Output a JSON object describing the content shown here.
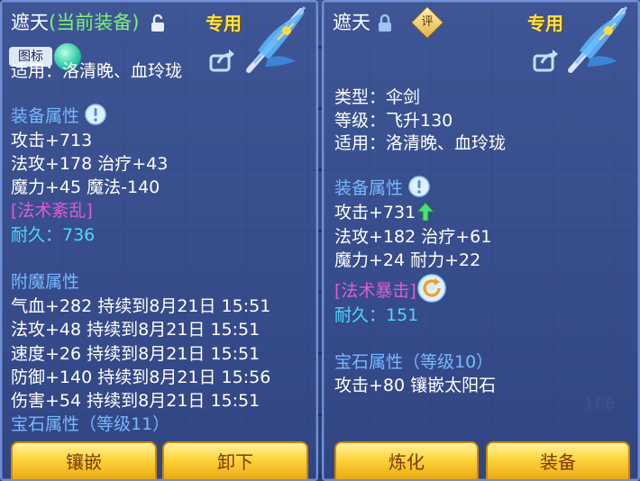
{
  "left_panel": {
    "title_name": "遮天",
    "title_state": "(当前装备)",
    "exclusive": "专用",
    "tag": "图标",
    "applies_partial": "适用：洛清晚、血玲珑",
    "attr_header": "装备属性",
    "stats": [
      "攻击+713",
      "法攻+178 治疗+43",
      "魔力+45 魔法-140"
    ],
    "special": "[法术紊乱]",
    "durability": "耐久：736",
    "enchant_header": "附魔属性",
    "enchants": [
      "气血+282 持续到8月21日 15:51",
      "法攻+48 持续到8月21日 15:51",
      "速度+26 持续到8月21日 15:51",
      "防御+140 持续到8月21日 15:56",
      "伤害+54 持续到8月21日 15:51"
    ],
    "gem_header": "宝石属性（等级11）",
    "buttons": [
      "镶嵌",
      "卸下"
    ]
  },
  "right_panel": {
    "title_name": "遮天",
    "rate_icon": "评",
    "exclusive": "专用",
    "type": "类型：伞剑",
    "level": "等级：飞升130",
    "applies": "适用：洛清晚、血玲珑",
    "attr_header": "装备属性",
    "stats": [
      "攻击+731",
      "法攻+182 治疗+61",
      "魔力+24 耐力+22"
    ],
    "special": "[法术暴击]",
    "durability": "耐久：151",
    "gem_header": "宝石属性（等级10）",
    "gem_stat": "攻击+80 镶嵌太阳石",
    "buttons": [
      "炼化",
      "装备"
    ]
  },
  "background": {
    "count": "166"
  },
  "colors": {
    "section": "#78b8ff",
    "special_left": "#ffd84a",
    "special_right": "#e05ad8",
    "durability": "#4cd8ff",
    "button": "#ffd43a"
  }
}
